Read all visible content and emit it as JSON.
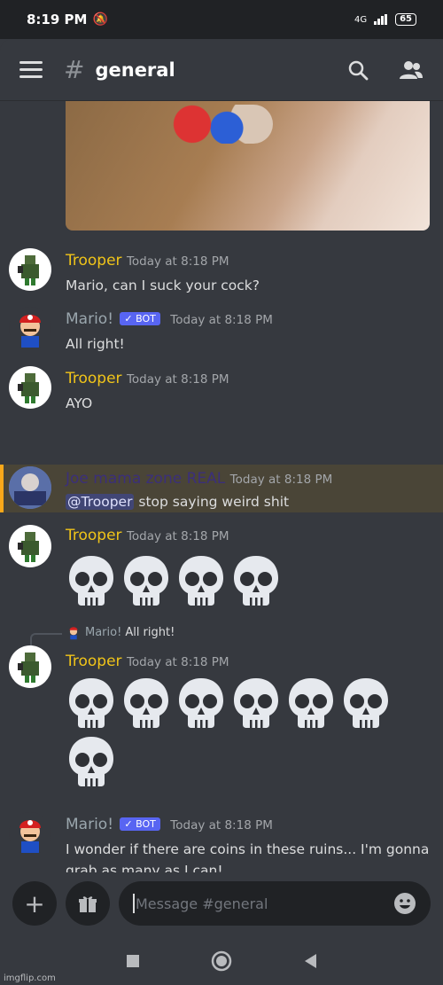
{
  "status_bar": {
    "time": "8:19 PM",
    "network": "4G",
    "battery": "65"
  },
  "header": {
    "channel_name": "general",
    "hash": "#"
  },
  "messages": [
    {
      "username": "Trooper",
      "username_color": "#f0c419",
      "timestamp": "Today at 8:18 PM",
      "text": "Mario, can I suck your cock?"
    },
    {
      "username": "Mario!",
      "username_color": "#9aa6ad",
      "bot_label": "BOT",
      "timestamp": "Today at 8:18 PM",
      "text": "All right!"
    },
    {
      "username": "Trooper",
      "username_color": "#f0c419",
      "timestamp": "Today at 8:18 PM",
      "text": "AYO"
    },
    {
      "username": "Joe mama zone REAL",
      "username_color": "#3b2f7a",
      "timestamp": "Today at 8:18 PM",
      "mention": "@Trooper",
      "text": " stop saying weird shit"
    },
    {
      "username": "Trooper",
      "username_color": "#f0c419",
      "timestamp": "Today at 8:18 PM",
      "skull_count": 4
    },
    {
      "reply_to": "Mario!",
      "reply_text": "All right!",
      "username": "Trooper",
      "username_color": "#f0c419",
      "timestamp": "Today at 8:18 PM",
      "skull_count": 7
    },
    {
      "username": "Mario!",
      "username_color": "#9aa6ad",
      "bot_label": "BOT",
      "timestamp": "Today at 8:18 PM",
      "text_line1": "I wonder if there are coins in these ruins... I'm gonna",
      "text_line2": "grab as many as I can!"
    }
  ],
  "composer": {
    "placeholder": "Message #general"
  },
  "watermark": "imgflip.com"
}
